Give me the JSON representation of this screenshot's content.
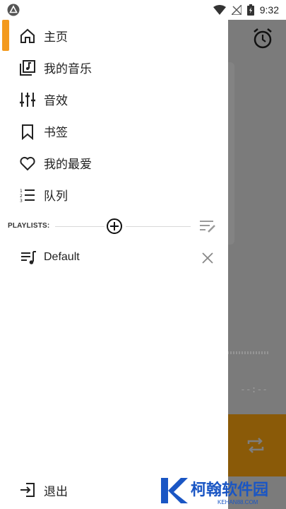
{
  "status_bar": {
    "time": "9:32",
    "icons": [
      "app-notification-icon",
      "wifi-icon",
      "no-signal-icon",
      "battery-icon"
    ]
  },
  "background": {
    "timer": "--:--",
    "accent_color": "#8a5a08"
  },
  "drawer": {
    "active_color": "#f39a1e",
    "items": [
      {
        "label": "主页",
        "icon": "home-icon"
      },
      {
        "label": "我的音乐",
        "icon": "music-library-icon"
      },
      {
        "label": "音效",
        "icon": "equalizer-icon"
      },
      {
        "label": "书签",
        "icon": "bookmark-icon"
      },
      {
        "label": "我的最爱",
        "icon": "heart-icon"
      },
      {
        "label": "队列",
        "icon": "queue-icon"
      }
    ],
    "playlists": {
      "header": "PLAYLISTS:",
      "items": [
        {
          "label": "Default"
        }
      ]
    },
    "exit_label": "退出"
  },
  "watermark": {
    "title": "柯翰软件园",
    "subtitle": "KEHAN88.COM"
  }
}
